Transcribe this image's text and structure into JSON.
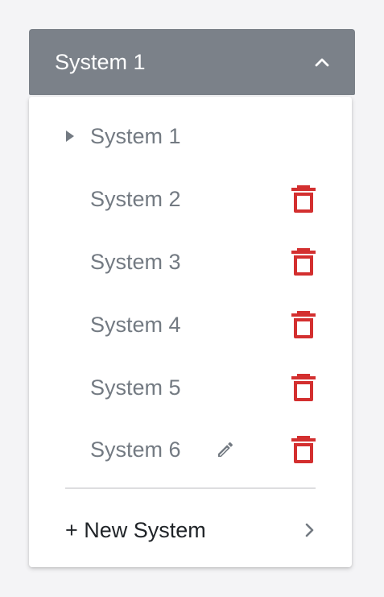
{
  "header": {
    "title": "System 1",
    "icon": "chevron-up-icon"
  },
  "menu": {
    "items": [
      {
        "label": "System 1",
        "active": true
      },
      {
        "label": "System 2",
        "active": false
      },
      {
        "label": "System 3",
        "active": false
      },
      {
        "label": "System 4",
        "active": false
      },
      {
        "label": "System 5",
        "active": false
      },
      {
        "label": "System 6",
        "active": false,
        "editable": true
      }
    ],
    "new_system_label": "+ New System",
    "icons": {
      "active": "caret-right-icon",
      "delete": "trash-icon",
      "edit": "pencil-icon",
      "submenu": "chevron-right-icon"
    }
  },
  "colors": {
    "header_bg": "#7b8189",
    "item_text": "#737a82",
    "trash": "#d32f2f",
    "page_bg": "#f4f4f6"
  }
}
